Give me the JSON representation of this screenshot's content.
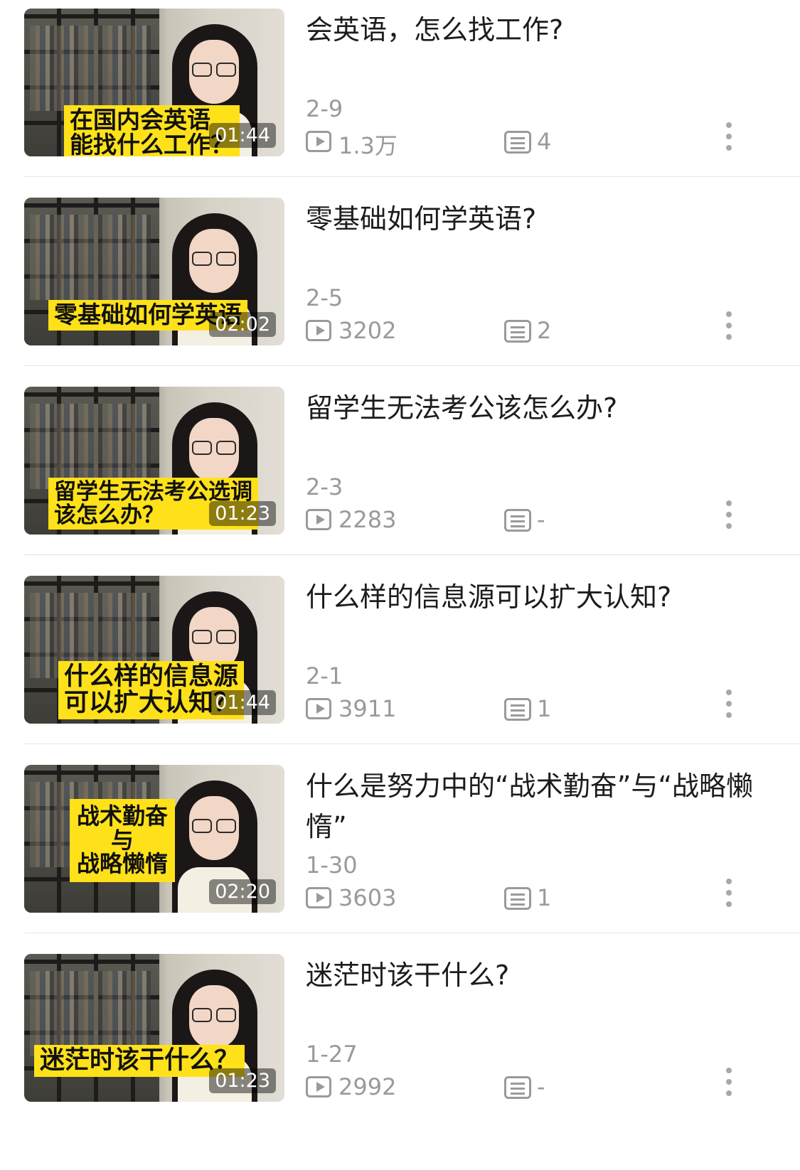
{
  "videos": [
    {
      "title": "会英语，怎么找工作?",
      "date": "2-9",
      "views": "1.3万",
      "comments": "4",
      "duration": "01:44",
      "banner_lines": [
        "在国内会英语",
        "能找什么工作？"
      ]
    },
    {
      "title": "零基础如何学英语?",
      "date": "2-5",
      "views": "3202",
      "comments": "2",
      "duration": "02:02",
      "banner_lines": [
        "零基础如何学英语"
      ]
    },
    {
      "title": "留学生无法考公该怎么办?",
      "date": "2-3",
      "views": "2283",
      "comments": "-",
      "duration": "01:23",
      "banner_lines": [
        "留学生无法考公选调",
        "该怎么办？"
      ]
    },
    {
      "title": "什么样的信息源可以扩大认知?",
      "date": "2-1",
      "views": "3911",
      "comments": "1",
      "duration": "01:44",
      "banner_lines": [
        "什么样的信息源",
        "可以扩大认知？"
      ]
    },
    {
      "title": "什么是努力中的“战术勤奋”与“战略懒惰”",
      "date": "1-30",
      "views": "3603",
      "comments": "1",
      "duration": "02:20",
      "banner_lines": [
        "战术勤奋",
        "与",
        "战略懒惰"
      ]
    },
    {
      "title": "迷茫时该干什么?",
      "date": "1-27",
      "views": "2992",
      "comments": "-",
      "duration": "01:23",
      "banner_lines": [
        "迷茫时该干什么？"
      ]
    }
  ],
  "colors": {
    "banner": "#ffe11a",
    "meta_text": "#9a9a9a",
    "title_text": "#1c1c1c"
  },
  "icons": {
    "views": "play-icon",
    "comments": "comment-list-icon",
    "more": "more-vertical-icon"
  }
}
